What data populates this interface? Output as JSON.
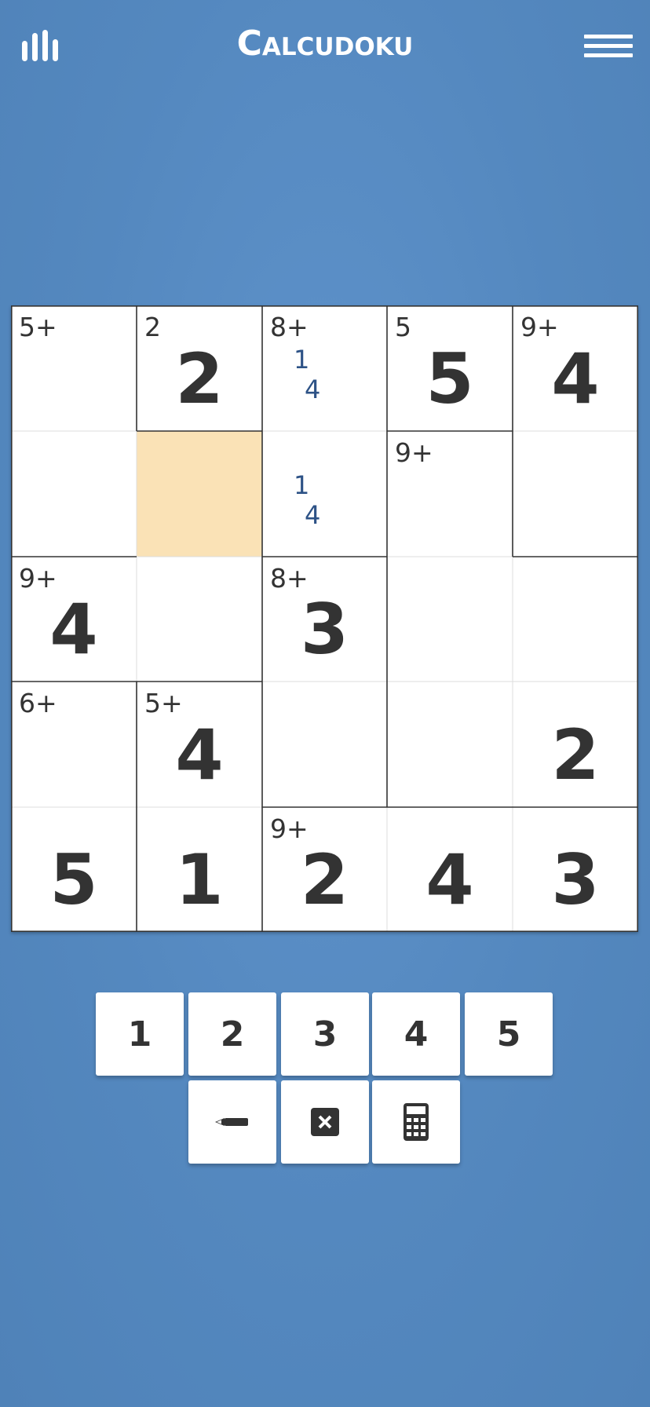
{
  "header": {
    "title": "Calcudoku",
    "stats_icon": "bar-chart-icon",
    "menu_icon": "hamburger-menu-icon"
  },
  "colors": {
    "background": "#5488bf",
    "selected_cell": "#fae2b6",
    "note_text": "#2d5286",
    "digit_text": "#333333"
  },
  "board": {
    "size": 5,
    "selected": {
      "row": 1,
      "col": 1
    },
    "cells": [
      [
        {
          "clue": "5+",
          "value": "",
          "notes": []
        },
        {
          "clue": "2",
          "value": "2",
          "notes": []
        },
        {
          "clue": "8+",
          "value": "",
          "notes": [
            "1",
            "4"
          ]
        },
        {
          "clue": "5",
          "value": "5",
          "notes": []
        },
        {
          "clue": "9+",
          "value": "4",
          "notes": []
        }
      ],
      [
        {
          "clue": "",
          "value": "",
          "notes": []
        },
        {
          "clue": "",
          "value": "",
          "notes": []
        },
        {
          "clue": "",
          "value": "",
          "notes": [
            "1",
            "4"
          ]
        },
        {
          "clue": "9+",
          "value": "",
          "notes": []
        },
        {
          "clue": "",
          "value": "",
          "notes": []
        }
      ],
      [
        {
          "clue": "9+",
          "value": "4",
          "notes": []
        },
        {
          "clue": "",
          "value": "",
          "notes": []
        },
        {
          "clue": "8+",
          "value": "3",
          "notes": []
        },
        {
          "clue": "",
          "value": "",
          "notes": []
        },
        {
          "clue": "",
          "value": "",
          "notes": []
        }
      ],
      [
        {
          "clue": "6+",
          "value": "",
          "notes": []
        },
        {
          "clue": "5+",
          "value": "4",
          "notes": []
        },
        {
          "clue": "",
          "value": "",
          "notes": []
        },
        {
          "clue": "",
          "value": "",
          "notes": []
        },
        {
          "clue": "",
          "value": "2",
          "notes": []
        }
      ],
      [
        {
          "clue": "",
          "value": "5",
          "notes": []
        },
        {
          "clue": "",
          "value": "1",
          "notes": []
        },
        {
          "clue": "9+",
          "value": "2",
          "notes": []
        },
        {
          "clue": "",
          "value": "4",
          "notes": []
        },
        {
          "clue": "",
          "value": "3",
          "notes": []
        }
      ]
    ]
  },
  "keypad": {
    "numbers": [
      "1",
      "2",
      "3",
      "4",
      "5"
    ],
    "tools": [
      {
        "name": "pencil-icon"
      },
      {
        "name": "erase-icon"
      },
      {
        "name": "calculator-icon"
      }
    ]
  }
}
